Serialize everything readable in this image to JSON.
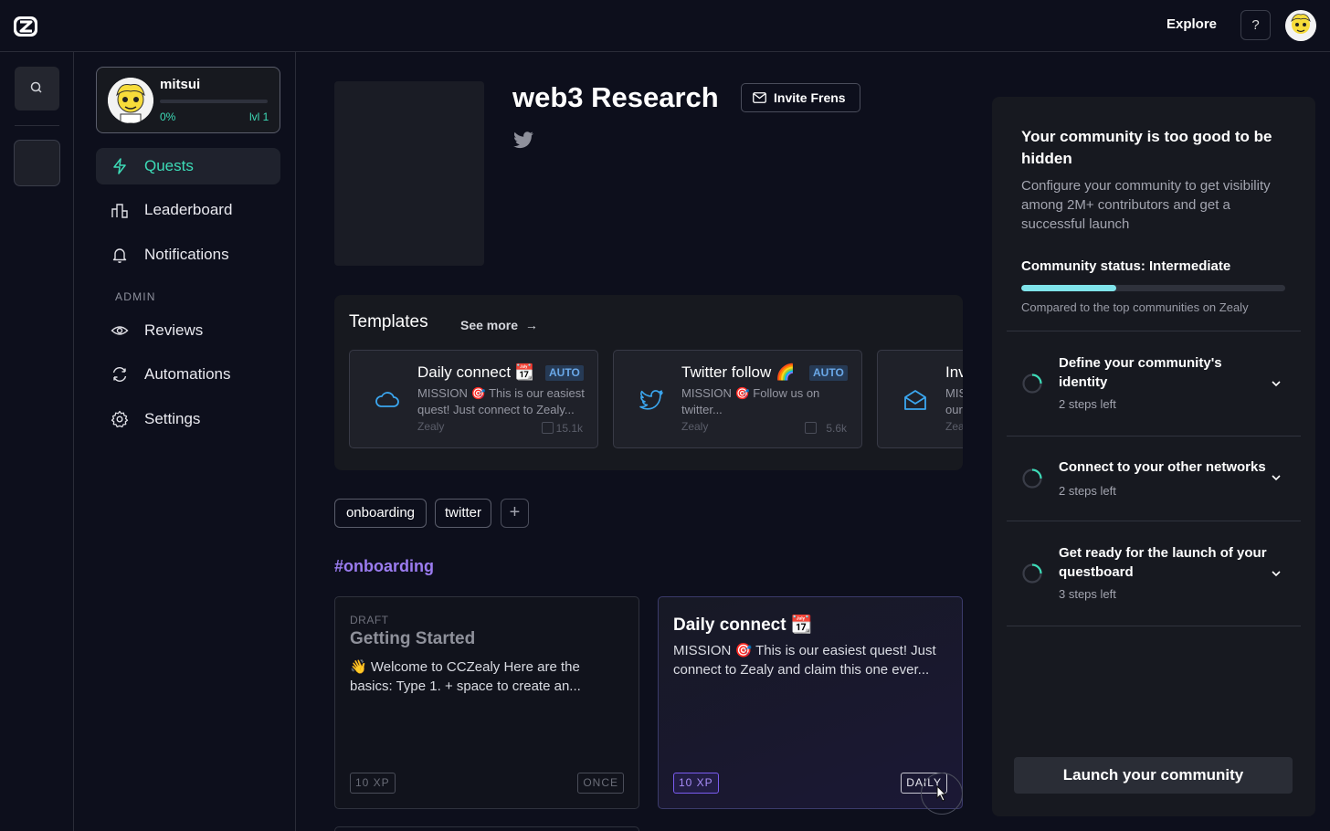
{
  "topbar": {
    "explore": "Explore",
    "help": "?"
  },
  "sidebar": {
    "profile": {
      "name": "mitsui",
      "progress": "0%",
      "level": "lvl 1",
      "progress_value": 0
    },
    "items": [
      {
        "label": "Quests",
        "icon": "lightning-icon",
        "active": true
      },
      {
        "label": "Leaderboard",
        "icon": "leaderboard-icon"
      },
      {
        "label": "Notifications",
        "icon": "bell-icon"
      }
    ],
    "admin_label": "ADMIN",
    "admin_items": [
      {
        "label": "Reviews",
        "icon": "eye-icon"
      },
      {
        "label": "Automations",
        "icon": "refresh-icon"
      },
      {
        "label": "Settings",
        "icon": "gear-icon"
      }
    ]
  },
  "main": {
    "title": "web3 Research",
    "invite": "Invite Frens",
    "templates": {
      "title": "Templates",
      "see_more": "See more",
      "cards": [
        {
          "title": "Daily connect 📆",
          "badge": "AUTO",
          "desc": "MISSION 🎯 This is our easiest quest! Just connect to Zealy...",
          "source": "Zealy",
          "count": "15.1k",
          "icon": "cloud-icon"
        },
        {
          "title": "Twitter follow 🌈",
          "badge": "AUTO",
          "desc": "MISSION 🎯 Follow us on twitter...",
          "source": "Zealy",
          "count": "5.6k",
          "icon": "twitter-icon"
        },
        {
          "title": "Inv",
          "badge": "",
          "desc": "MIS our",
          "source": "Zea",
          "count": "",
          "icon": "mail-icon"
        }
      ]
    },
    "tags": [
      "onboarding",
      "twitter"
    ],
    "section": "#onboarding",
    "quests": [
      {
        "status": "DRAFT",
        "title": "Getting Started",
        "desc": "👋 Welcome to CCZealy Here are the basics: Type 1. + space to create an...",
        "xp": "10 XP",
        "frequency": "ONCE"
      },
      {
        "status": "",
        "title": "Daily connect 📆",
        "desc": "MISSION 🎯 This is our easiest quest! Just connect to Zealy and claim this one ever...",
        "xp": "10 XP",
        "frequency": "DAILY"
      }
    ]
  },
  "right_panel": {
    "title": "Your community is too good to be hidden",
    "desc": "Configure your community to get visibility among 2M+ contributors and get a successful launch",
    "status": "Community status: Intermediate",
    "status_progress": 0.36,
    "compare": "Compared to the top communities on Zealy",
    "steps": [
      {
        "title": "Define your community's identity",
        "sub": "2 steps left"
      },
      {
        "title": "Connect to your other networks",
        "sub": "2 steps left"
      },
      {
        "title": "Get ready for the launch of your questboard",
        "sub": "3 steps left"
      }
    ],
    "launch": "Launch your community"
  },
  "colors": {
    "accent": "#3ddbb7",
    "purple": "#9b7cf0",
    "progress": "#7fe3ea"
  }
}
